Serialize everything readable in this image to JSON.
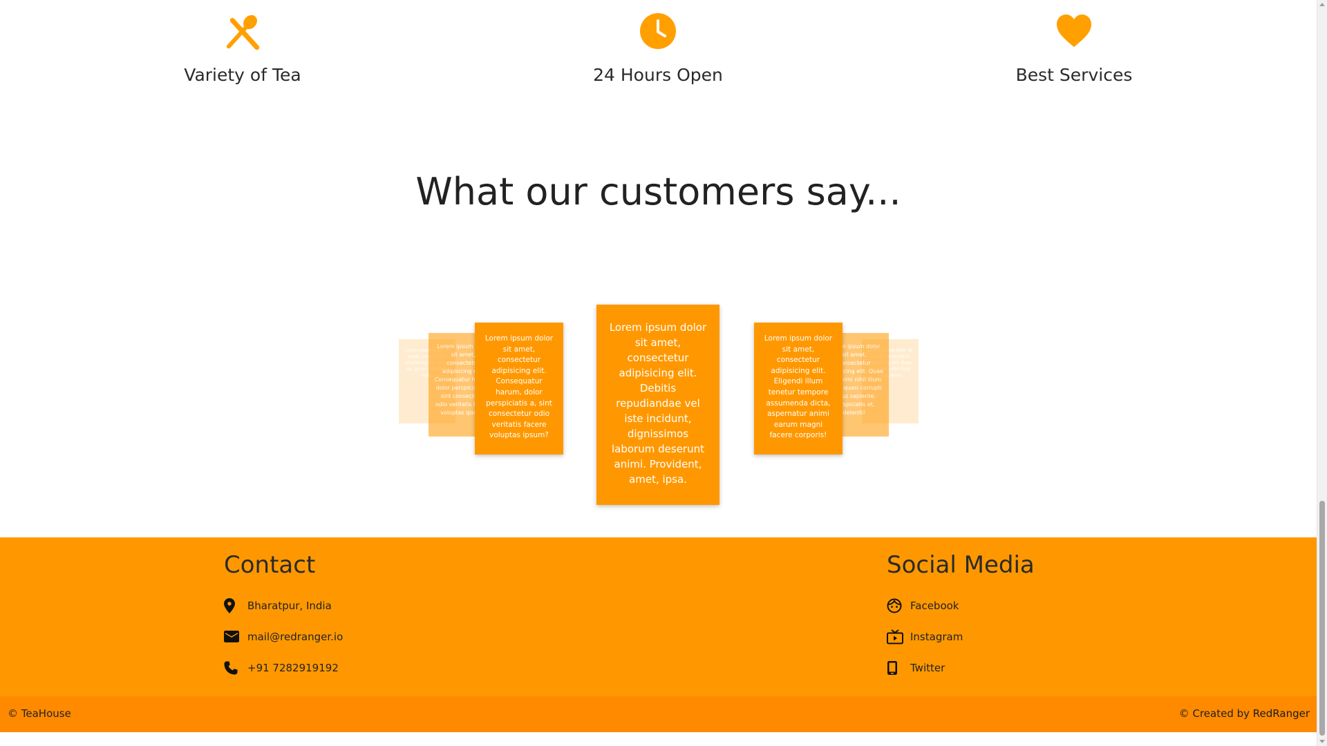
{
  "features": [
    {
      "label": "Variety of Tea",
      "icon": "utensils-icon"
    },
    {
      "label": "24 Hours Open",
      "icon": "clock-icon"
    },
    {
      "label": "Best Services",
      "icon": "heart-icon"
    }
  ],
  "testimonials": {
    "title": "What our customers say...",
    "center": "Lorem ipsum dolor sit amet, consectetur adipisicing elit. Debitis repudiandae vel iste incidunt, dignissimos laborum deserunt animi. Provident, amet, ipsa.",
    "left1": "Lorem ipsum dolor sit amet, consectetur adipisicing elit. Consequatur harum, dolor perspiciatis a, sint consectetur odio veritatis facere voluptas ipsum?",
    "right1": "Lorem ipsum dolor sit amet, consectetur adipisicing elit. Eligendi illum tenetur tempore assumenda dicta, aspernatur animi earum magni facere corporis!",
    "left2": "Lorem ipsum dolor sit amet, consectetur adipisicing elit. Consequatur harum, dolor perspiciatis a, sint consectetur odio veritatis facere voluptas ipsum?",
    "right2": "Lorem ipsum dolor sit amet, consectetur adipisicing elit. Quae ex, animi nihil illum nulla, quasi corrupti natus sapiente, perspiciatis et, deleniti!",
    "left3": "Lorem ipsum dolor sit amet, consectetur adipisicing elit. Quae ex, animi nihil illum nulla.",
    "right3": "Lorem ipsum dolor sit amet, consectetur adipisicing elit. Quae ex, animi nihil illum nulla, quasi."
  },
  "contact": {
    "title": "Contact",
    "items": [
      {
        "icon": "location-pin-icon",
        "text": "Bharatpur, India"
      },
      {
        "icon": "mail-icon",
        "text": "mail@redranger.io"
      },
      {
        "icon": "phone-icon",
        "text": "+91 7282919192"
      }
    ]
  },
  "social": {
    "title": "Social Media",
    "items": [
      {
        "icon": "face-icon",
        "text": "Facebook"
      },
      {
        "icon": "tv-icon",
        "text": "Instagram"
      },
      {
        "icon": "smartphone-icon",
        "text": "Twitter"
      }
    ]
  },
  "footer": {
    "left": "© TeaHouse",
    "right_prefix": "© Created by ",
    "right_brand": "RedRanger"
  },
  "colors": {
    "accent": "#ff9800",
    "footer_bottom": "#ff8a00",
    "icon": "#ffa000"
  }
}
